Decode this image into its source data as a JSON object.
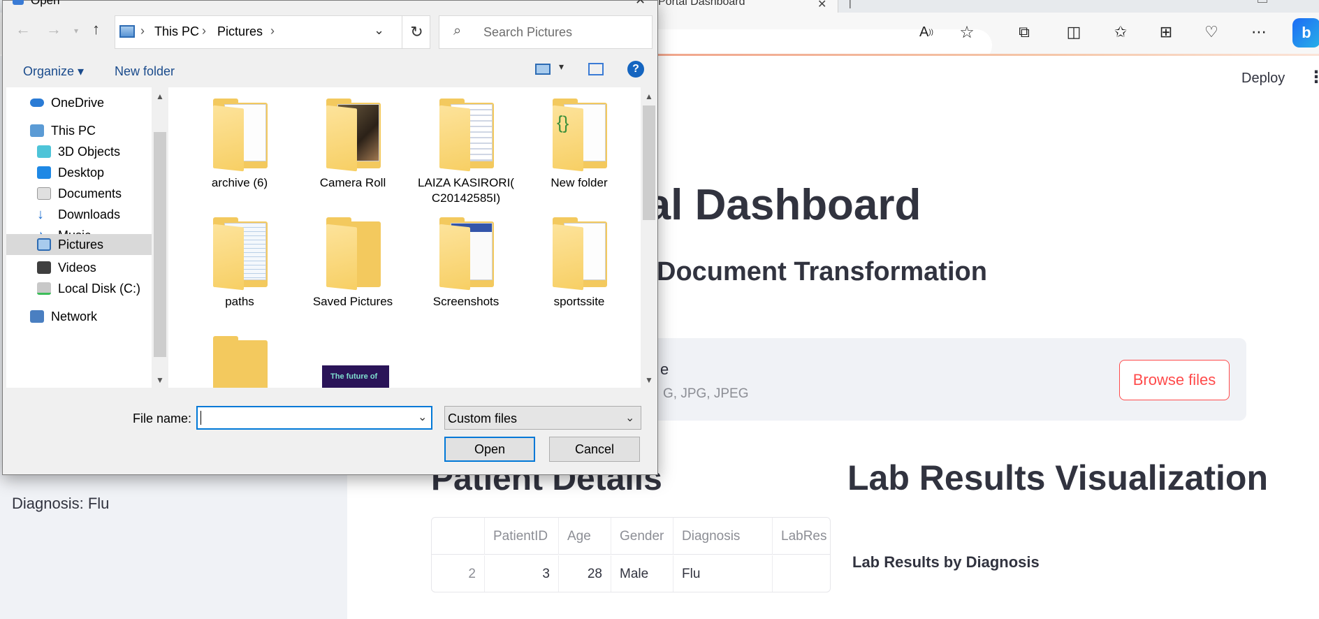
{
  "browser": {
    "tab_title": "Portal Dashboard",
    "deploy_label": "Deploy",
    "kebab": "⋮",
    "copilot": "b"
  },
  "app": {
    "title_partial": "tal Dashboard",
    "subtitle_partial": "Document Transformation",
    "uploader": {
      "label_partial": "e",
      "types_partial": "G, JPG, JPEG",
      "browse_label": "Browse files"
    },
    "patient_heading_partial": "Patient Details",
    "lab_heading": "Lab Results Visualization",
    "chart_title": "Lab Results by Diagnosis",
    "sidebar_diagnosis": "Diagnosis: Flu",
    "table": {
      "columns": [
        "",
        "PatientID",
        "Age",
        "Gender",
        "Diagnosis",
        "LabRes"
      ],
      "row": [
        "2",
        "3",
        "28",
        "Male",
        "Flu",
        ""
      ]
    }
  },
  "dialog": {
    "title": "Open",
    "path": [
      "This PC",
      "Pictures"
    ],
    "search_placeholder": "Search Pictures",
    "organize_label": "Organize ▾",
    "new_folder_label": "New folder",
    "nav_items": [
      {
        "label": "OneDrive",
        "icon": "cloud-icon"
      },
      {
        "label": "This PC",
        "icon": "computer-icon"
      },
      {
        "label": "3D Objects",
        "icon": "cube-icon"
      },
      {
        "label": "Desktop",
        "icon": "desktop-icon"
      },
      {
        "label": "Documents",
        "icon": "document-icon"
      },
      {
        "label": "Downloads",
        "icon": "download-icon"
      },
      {
        "label": "Music",
        "icon": "music-icon"
      },
      {
        "label": "Pictures",
        "icon": "pictures-icon"
      },
      {
        "label": "Videos",
        "icon": "video-icon"
      },
      {
        "label": "Local Disk (C:)",
        "icon": "disk-icon"
      },
      {
        "label": "Network",
        "icon": "network-icon"
      }
    ],
    "folders": [
      {
        "label": "archive (6)"
      },
      {
        "label": "Camera Roll"
      },
      {
        "label": "LAIZA KASIRORI( C20142585I)"
      },
      {
        "label": "New folder"
      },
      {
        "label": "paths"
      },
      {
        "label": "Saved Pictures"
      },
      {
        "label": "Screenshots"
      },
      {
        "label": "sportssite"
      }
    ],
    "partial_thumb_text": "The future of",
    "file_name_label": "File name:",
    "file_name_value": "",
    "filter_value": "Custom files",
    "open_label": "Open",
    "cancel_label": "Cancel"
  },
  "colors": {
    "accent_red": "#ff4b4b",
    "dialog_focus": "#0078d7",
    "nav_selected": "#cce8ff"
  }
}
